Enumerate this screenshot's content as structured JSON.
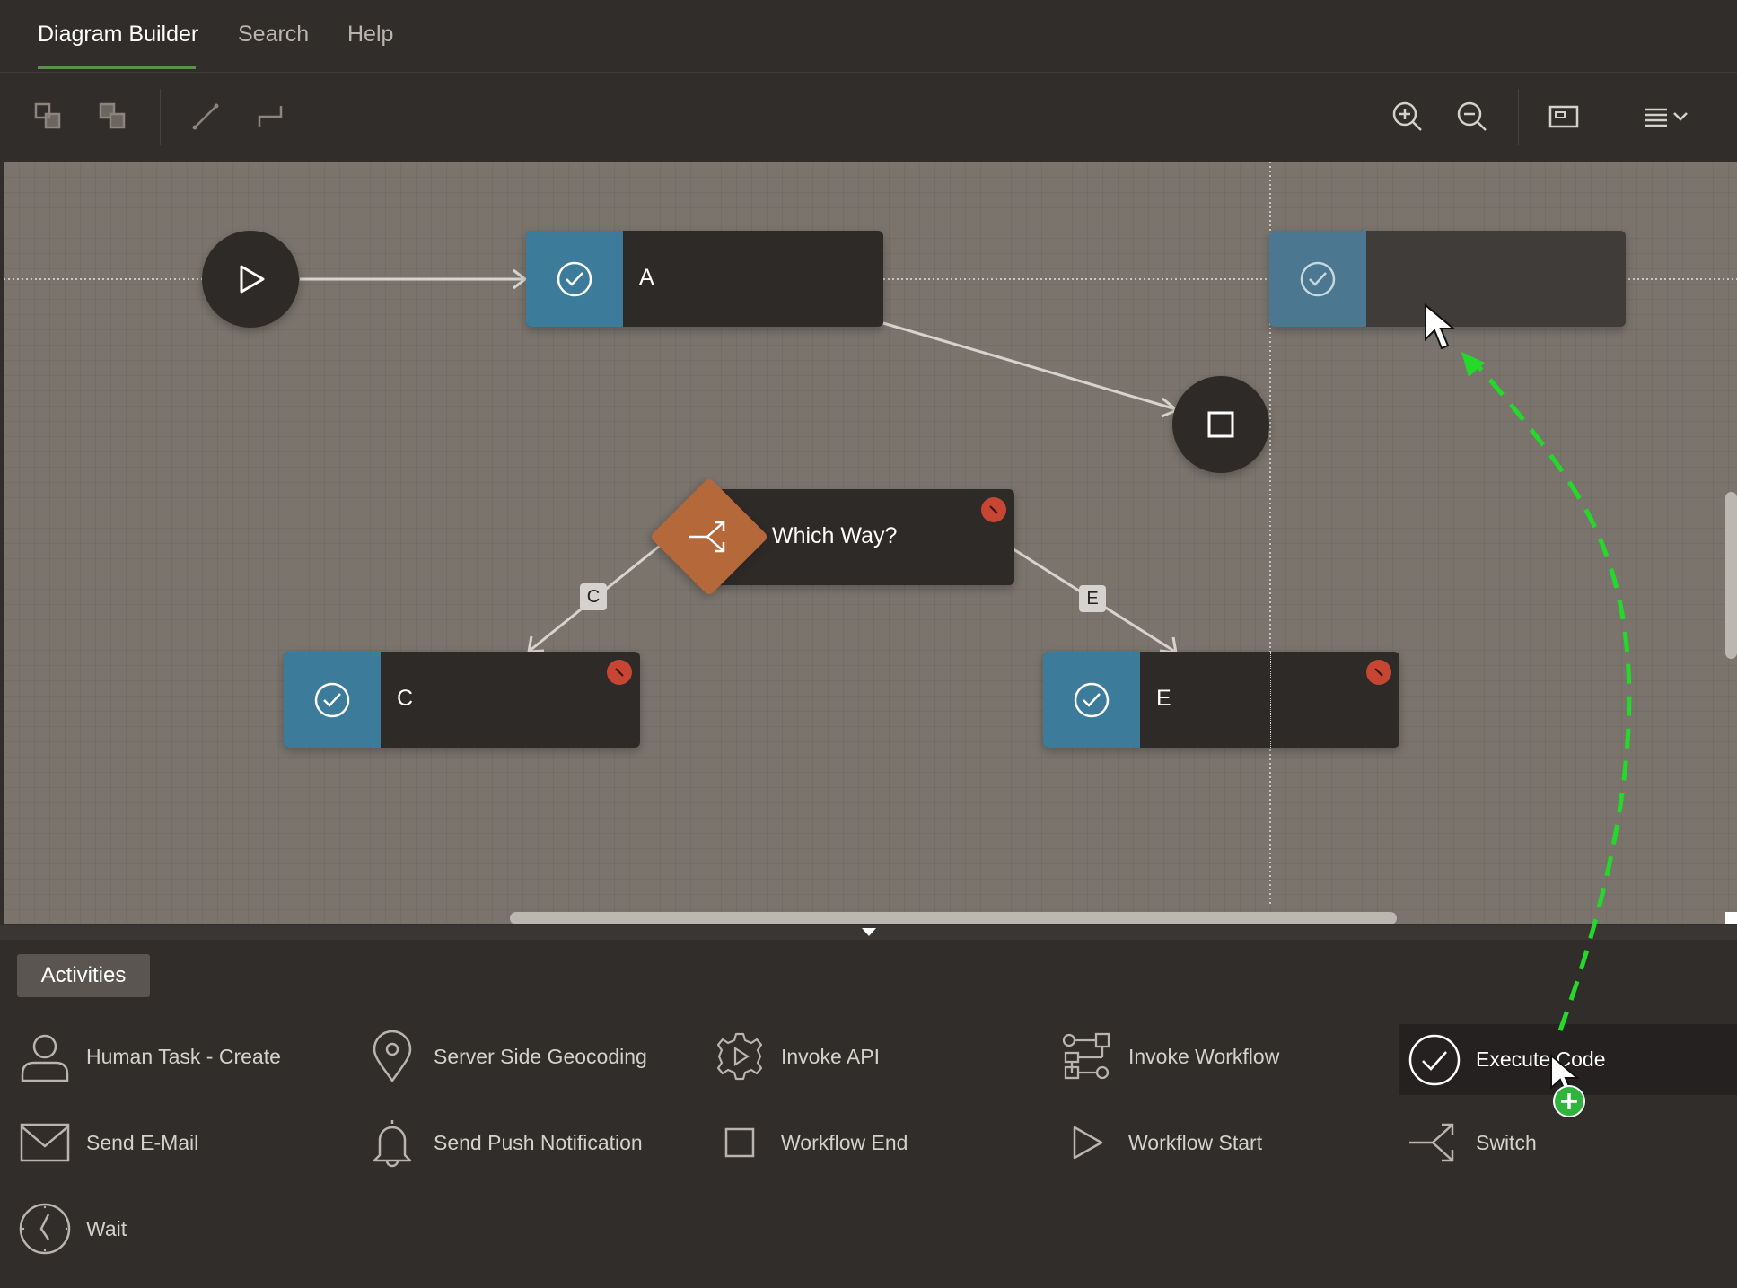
{
  "tabs": [
    {
      "label": "Diagram Builder",
      "active": true
    },
    {
      "label": "Search",
      "active": false
    },
    {
      "label": "Help",
      "active": false
    }
  ],
  "toolbar": {
    "icons": [
      "bring-to-front-icon",
      "send-to-back-icon",
      "straight-line-icon",
      "elbow-line-icon",
      "zoom-in-icon",
      "zoom-out-icon",
      "fit-to-screen-icon",
      "menu-icon"
    ]
  },
  "diagram": {
    "nodes": {
      "a": "A",
      "c": "C",
      "e": "E",
      "ghost": "",
      "switch": "Which Way?"
    },
    "connector_labels": {
      "c": "C",
      "e": "E"
    }
  },
  "palette": {
    "tab_label": "Activities",
    "items": [
      {
        "label": "Human Task - Create",
        "icon": "person-icon"
      },
      {
        "label": "Server Side Geocoding",
        "icon": "map-pin-icon"
      },
      {
        "label": "Invoke API",
        "icon": "gear-icon"
      },
      {
        "label": "Invoke Workflow",
        "icon": "workflow-icon"
      },
      {
        "label": "Execute Code",
        "icon": "check-circle-icon",
        "selected": true
      },
      {
        "label": "Send E-Mail",
        "icon": "envelope-icon"
      },
      {
        "label": "Send Push Notification",
        "icon": "bell-icon"
      },
      {
        "label": "Workflow End",
        "icon": "square-icon"
      },
      {
        "label": "Workflow Start",
        "icon": "play-icon"
      },
      {
        "label": "Switch",
        "icon": "switch-icon"
      },
      {
        "label": "Wait",
        "icon": "clock-icon"
      }
    ]
  },
  "colors": {
    "activity_blue": "#3d7b9b",
    "switch_orange": "#b5683a",
    "error_red": "#c74633",
    "drag_path_green": "#23d92a",
    "tab_underline_green": "#5e8f4f"
  }
}
